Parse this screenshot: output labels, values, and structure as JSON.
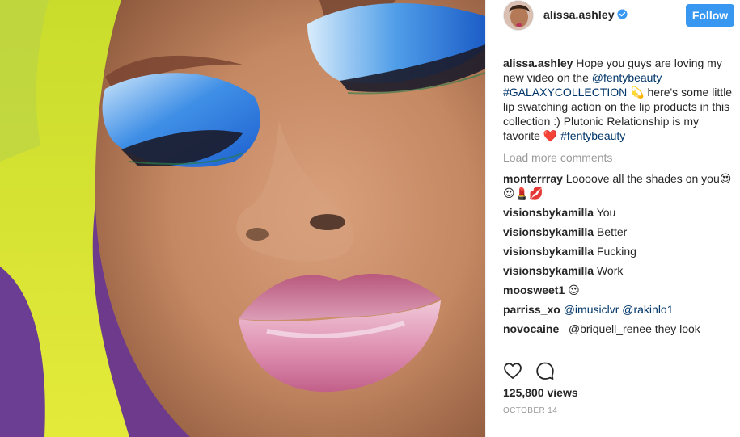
{
  "post": {
    "username": "alissa.ashley",
    "follow_label": "Follow",
    "caption": {
      "user": "alissa.ashley",
      "text_1": " Hope you guys are loving my new video on the ",
      "mention": "@fentybeauty",
      "text_2": " ",
      "hashtag_1": "#GALAXYCOLLECTION",
      "text_3": " 💫 here's some little lip swatching action on the lip products in this collection :) Plutonic Relationship is my favorite ❤️ ",
      "hashtag_2": "#fentybeauty"
    },
    "load_more_label": "Load more comments",
    "comments": [
      {
        "user": "monterrray",
        "text": " Loooove all the shades on you😍😍💄💋"
      },
      {
        "user": "visionsbykamilla",
        "text": " You"
      },
      {
        "user": "visionsbykamilla",
        "text": " Better"
      },
      {
        "user": "visionsbykamilla",
        "text": " Fucking"
      },
      {
        "user": "visionsbykamilla",
        "text": " Work"
      },
      {
        "user": "moosweet1",
        "text": " 😍"
      },
      {
        "user": "parriss_xo",
        "text": " @imusiclvr @rakinlo1"
      },
      {
        "user": "novocaine_",
        "text": " @briquell_renee they look"
      }
    ],
    "views": "125,800 views",
    "date": "OCTOBER 14"
  },
  "icons": {
    "like": "heart-icon",
    "comment": "comment-bubble-icon",
    "verified": "verified-badge-icon"
  },
  "colors": {
    "follow_button": "#3897f0",
    "hashtag": "#003569",
    "muted": "#999999",
    "eyeshadow_blue": "#2f74d6",
    "lip_pink": "#d98aa6"
  }
}
